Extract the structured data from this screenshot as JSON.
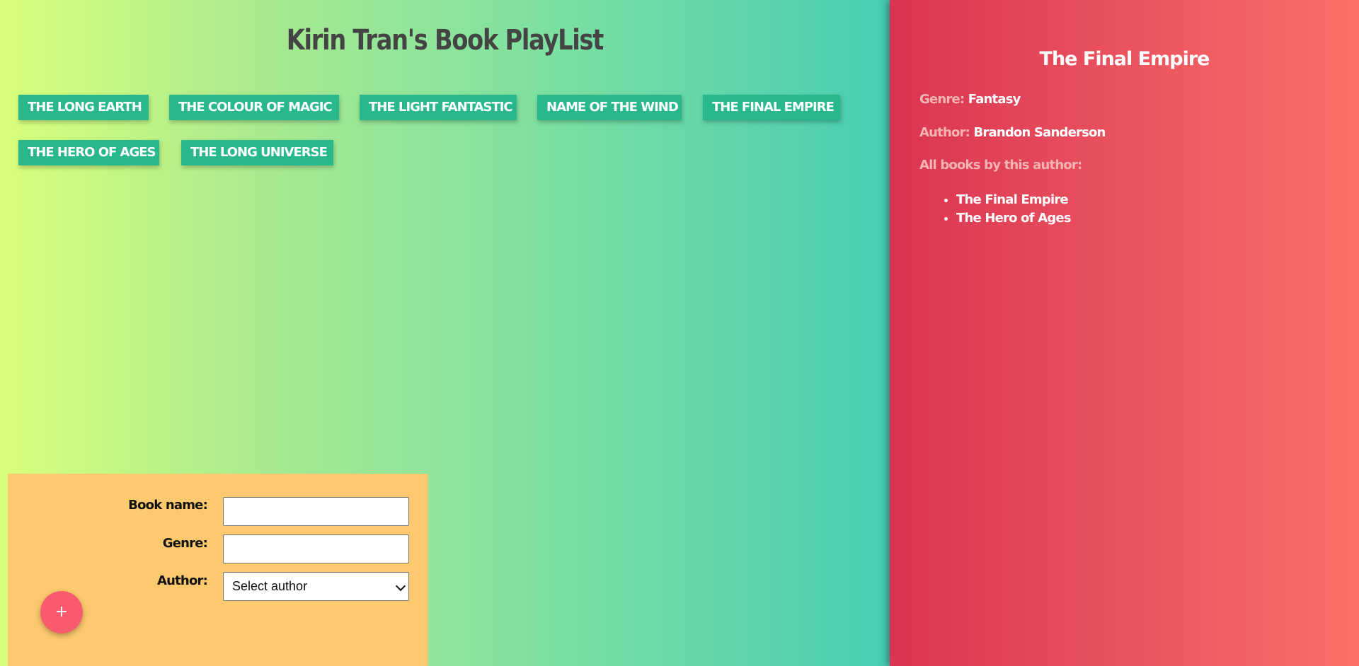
{
  "header": {
    "title": "Kirin Tran's Book PlayList"
  },
  "book_list": [
    "THE LONG EARTH",
    "THE COLOUR OF MAGIC",
    "THE LIGHT FANTASTIC",
    "NAME OF THE WIND",
    "THE FINAL EMPIRE",
    "THE HERO OF AGES",
    "THE LONG UNIVERSE"
  ],
  "details": {
    "title": "The Final Empire",
    "genre_label": "Genre:",
    "genre_value": "Fantasy",
    "author_label": "Author:",
    "author_value": "Brandon Sanderson",
    "all_books_label": "All books by this author:",
    "author_books": [
      "The Final Empire",
      "The Hero of Ages"
    ]
  },
  "form": {
    "book_name_label": "Book name:",
    "book_name_value": "",
    "genre_label": "Genre:",
    "genre_value": "",
    "author_label": "Author:",
    "author_selected": "Select author",
    "add_button_label": "+"
  },
  "colors": {
    "book_button": "#29b88c",
    "details_panel": "#e8505e",
    "form_panel": "#fdc96e",
    "add_button": "#fa5a6e"
  }
}
